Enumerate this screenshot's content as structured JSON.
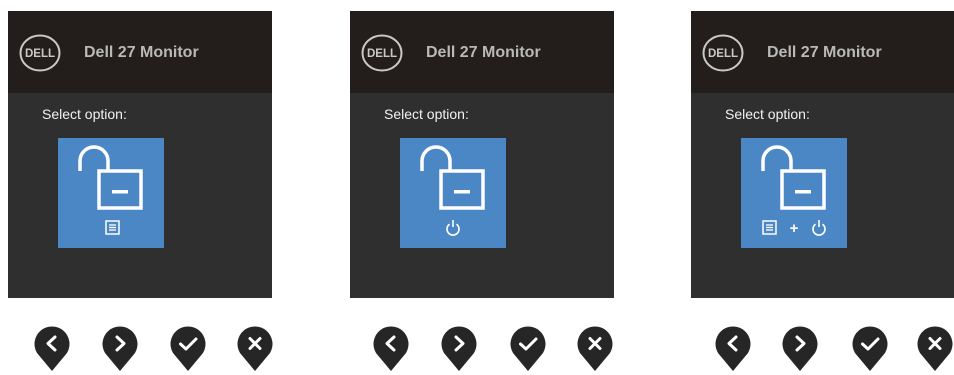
{
  "panels": [
    {
      "logo_text": "DELL",
      "title": "Dell 27 Monitor",
      "prompt": "Select option:",
      "option_icon": "unlock-menu-icon"
    },
    {
      "logo_text": "DELL",
      "title": "Dell 27 Monitor",
      "prompt": "Select option:",
      "option_icon": "unlock-power-icon"
    },
    {
      "logo_text": "DELL",
      "title": "Dell 27 Monitor",
      "prompt": "Select option:",
      "option_icon": "unlock-menu-plus-power-icon",
      "plus_text": "+"
    }
  ],
  "buttons": [
    "chevron-left-icon",
    "chevron-right-icon",
    "checkmark-icon",
    "close-icon"
  ],
  "colors": {
    "panel_bg": "#2f2f2f",
    "header_bg": "#231d1b",
    "tile_bg": "#4b86c5",
    "button_fill": "#262626"
  }
}
